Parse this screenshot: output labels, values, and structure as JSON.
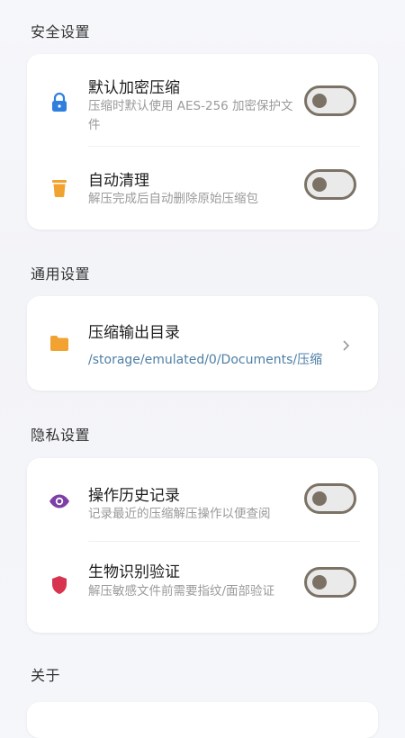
{
  "sections": {
    "security": {
      "title": "安全设置",
      "items": [
        {
          "title": "默认加密压缩",
          "desc": "压缩时默认使用 AES-256 加密保护文件",
          "icon": "lock-icon",
          "toggle": "off"
        },
        {
          "title": "自动清理",
          "desc": "解压完成后自动删除原始压缩包",
          "icon": "trash-icon",
          "toggle": "off"
        }
      ]
    },
    "general": {
      "title": "通用设置",
      "items": [
        {
          "title": "压缩输出目录",
          "value": "/storage/emulated/0/Documents/压缩",
          "icon": "folder-icon"
        }
      ]
    },
    "privacy": {
      "title": "隐私设置",
      "items": [
        {
          "title": "操作历史记录",
          "desc": "记录最近的压缩解压操作以便查阅",
          "icon": "eye-icon",
          "toggle": "off"
        },
        {
          "title": "生物识别验证",
          "desc": "解压敏感文件前需要指纹/面部验证",
          "icon": "shield-icon",
          "toggle": "off"
        }
      ]
    },
    "about": {
      "title": "关于"
    }
  },
  "colors": {
    "lock": "#2f7fde",
    "trash": "#f2a230",
    "folder": "#f2a230",
    "eye": "#7b3fa6",
    "shield": "#d8344f",
    "toggle_border": "#7b7265",
    "path_text": "#4d7fa6"
  }
}
